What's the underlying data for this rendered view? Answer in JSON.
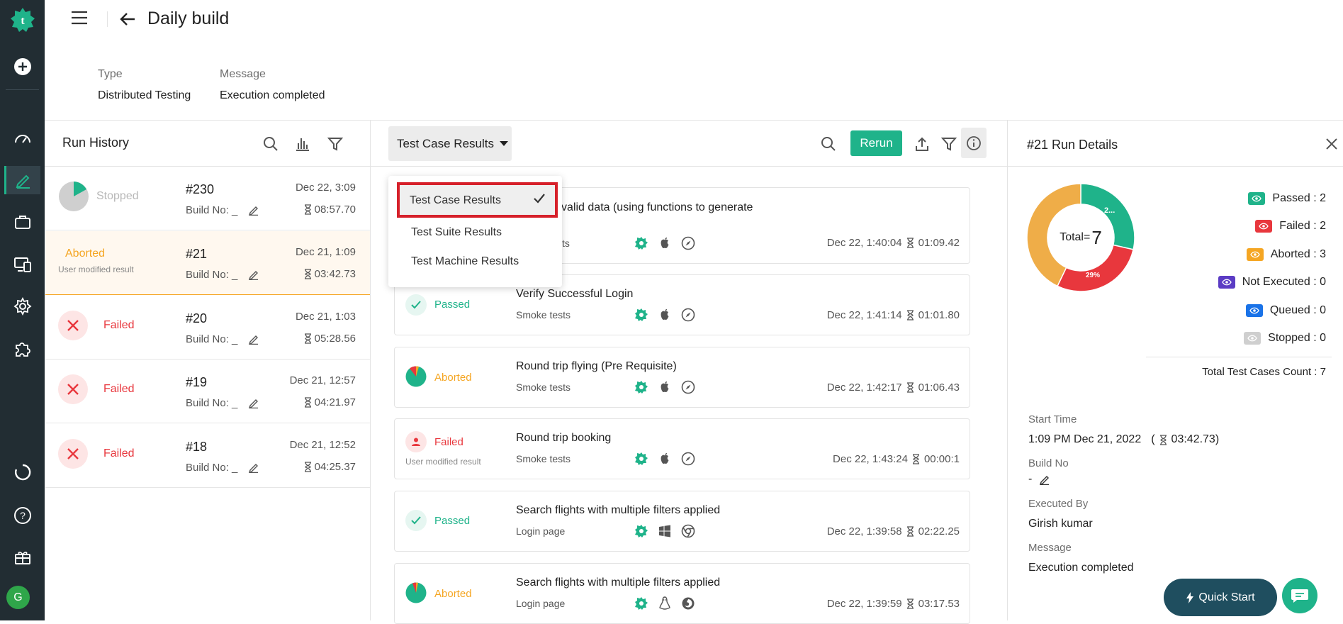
{
  "header": {
    "title": "Daily build",
    "type_label": "Type",
    "type_value": "Distributed Testing",
    "message_label": "Message",
    "message_value": "Execution completed"
  },
  "rail": {
    "avatar_letter": "G"
  },
  "run_history": {
    "title": "Run History",
    "runs": [
      {
        "status": "Stopped",
        "number": "#230",
        "build": "Build No: _",
        "date": "Dec 22, 3:09",
        "duration": "08:57.70",
        "note": ""
      },
      {
        "status": "Aborted",
        "number": "#21",
        "build": "Build No: _",
        "date": "Dec 21, 1:09",
        "duration": "03:42.73",
        "note": "User modified result"
      },
      {
        "status": "Failed",
        "number": "#20",
        "build": "Build No: _",
        "date": "Dec 21, 1:03",
        "duration": "05:28.56",
        "note": ""
      },
      {
        "status": "Failed",
        "number": "#19",
        "build": "Build No: _",
        "date": "Dec 21, 12:57",
        "duration": "04:21.97",
        "note": ""
      },
      {
        "status": "Failed",
        "number": "#18",
        "build": "Build No: _",
        "date": "Dec 21, 12:52",
        "duration": "04:25.37",
        "note": ""
      }
    ]
  },
  "center": {
    "dropdown_label": "Test Case Results",
    "rerun_label": "Rerun",
    "dropdown_options": [
      "Test Case Results",
      "Test Suite Results",
      "Test Machine Results"
    ],
    "selected_option": "Test Case Results",
    "cards": [
      {
        "status": "",
        "name": "nup with valid data (using functions to generate",
        "name2": ")",
        "suite": "ts",
        "os": "mac",
        "browser": "safari",
        "date": "Dec 22, 1:40:04",
        "duration": "01:09.42",
        "note": ""
      },
      {
        "status": "Passed",
        "name": "Verify Successful Login",
        "name2": "",
        "suite": "Smoke tests",
        "os": "mac",
        "browser": "safari",
        "date": "Dec 22, 1:41:14",
        "duration": "01:01.80",
        "note": ""
      },
      {
        "status": "Aborted",
        "name": "Round trip flying (Pre Requisite)",
        "name2": "",
        "suite": "Smoke tests",
        "os": "mac",
        "browser": "safari",
        "date": "Dec 22, 1:42:17",
        "duration": "01:06.43",
        "note": ""
      },
      {
        "status": "Failed",
        "name": "Round trip booking",
        "name2": "",
        "suite": "Smoke tests",
        "os": "mac",
        "browser": "safari",
        "date": "Dec 22, 1:43:24",
        "duration": "00:00:1",
        "note": "User modified result"
      },
      {
        "status": "Passed",
        "name": "Search flights with multiple filters applied",
        "name2": "",
        "suite": "Login page",
        "os": "windows",
        "browser": "chrome",
        "date": "Dec 22, 1:39:58",
        "duration": "02:22.25",
        "note": ""
      },
      {
        "status": "Aborted",
        "name": "Search flights with multiple filters applied",
        "name2": "",
        "suite": "Login page",
        "os": "linux",
        "browser": "firefox",
        "date": "Dec 22, 1:39:59",
        "duration": "03:17.53",
        "note": ""
      }
    ]
  },
  "details": {
    "title": "#21 Run Details",
    "donut": {
      "total_label": "Total=",
      "total_value": "7",
      "slice_labels": [
        "2...",
        "29%"
      ],
      "slices": [
        {
          "name": "Passed",
          "value": 2,
          "color": "#1fb38a"
        },
        {
          "name": "Failed",
          "value": 2,
          "color": "#e8373d"
        },
        {
          "name": "Aborted",
          "value": 3,
          "color": "#efad48"
        }
      ]
    },
    "legend": [
      {
        "label": "Passed : 2",
        "color": "#1fb38a"
      },
      {
        "label": "Failed : 2",
        "color": "#e8373d"
      },
      {
        "label": "Aborted : 3",
        "color": "#f5a623"
      },
      {
        "label": "Not Executed : 0",
        "color": "#5b3cc4"
      },
      {
        "label": "Queued : 0",
        "color": "#1a73e8"
      },
      {
        "label": "Stopped : 0",
        "color": "#cfcfcf"
      }
    ],
    "total_count": "Total Test Cases Count : 7",
    "start_time_label": "Start Time",
    "start_time_value": "1:09 PM Dec 21, 2022",
    "start_duration": "03:42.73)",
    "build_no_label": "Build No",
    "build_no_value": "-",
    "executed_by_label": "Executed By",
    "executed_by_value": "Girish kumar",
    "message_label": "Message",
    "message_value": "Execution completed",
    "quick_start_label": "Quick Start"
  },
  "colors": {
    "brand": "#1fb38a",
    "failed": "#e8373d",
    "aborted": "#f5a623",
    "rail": "#222d33"
  }
}
